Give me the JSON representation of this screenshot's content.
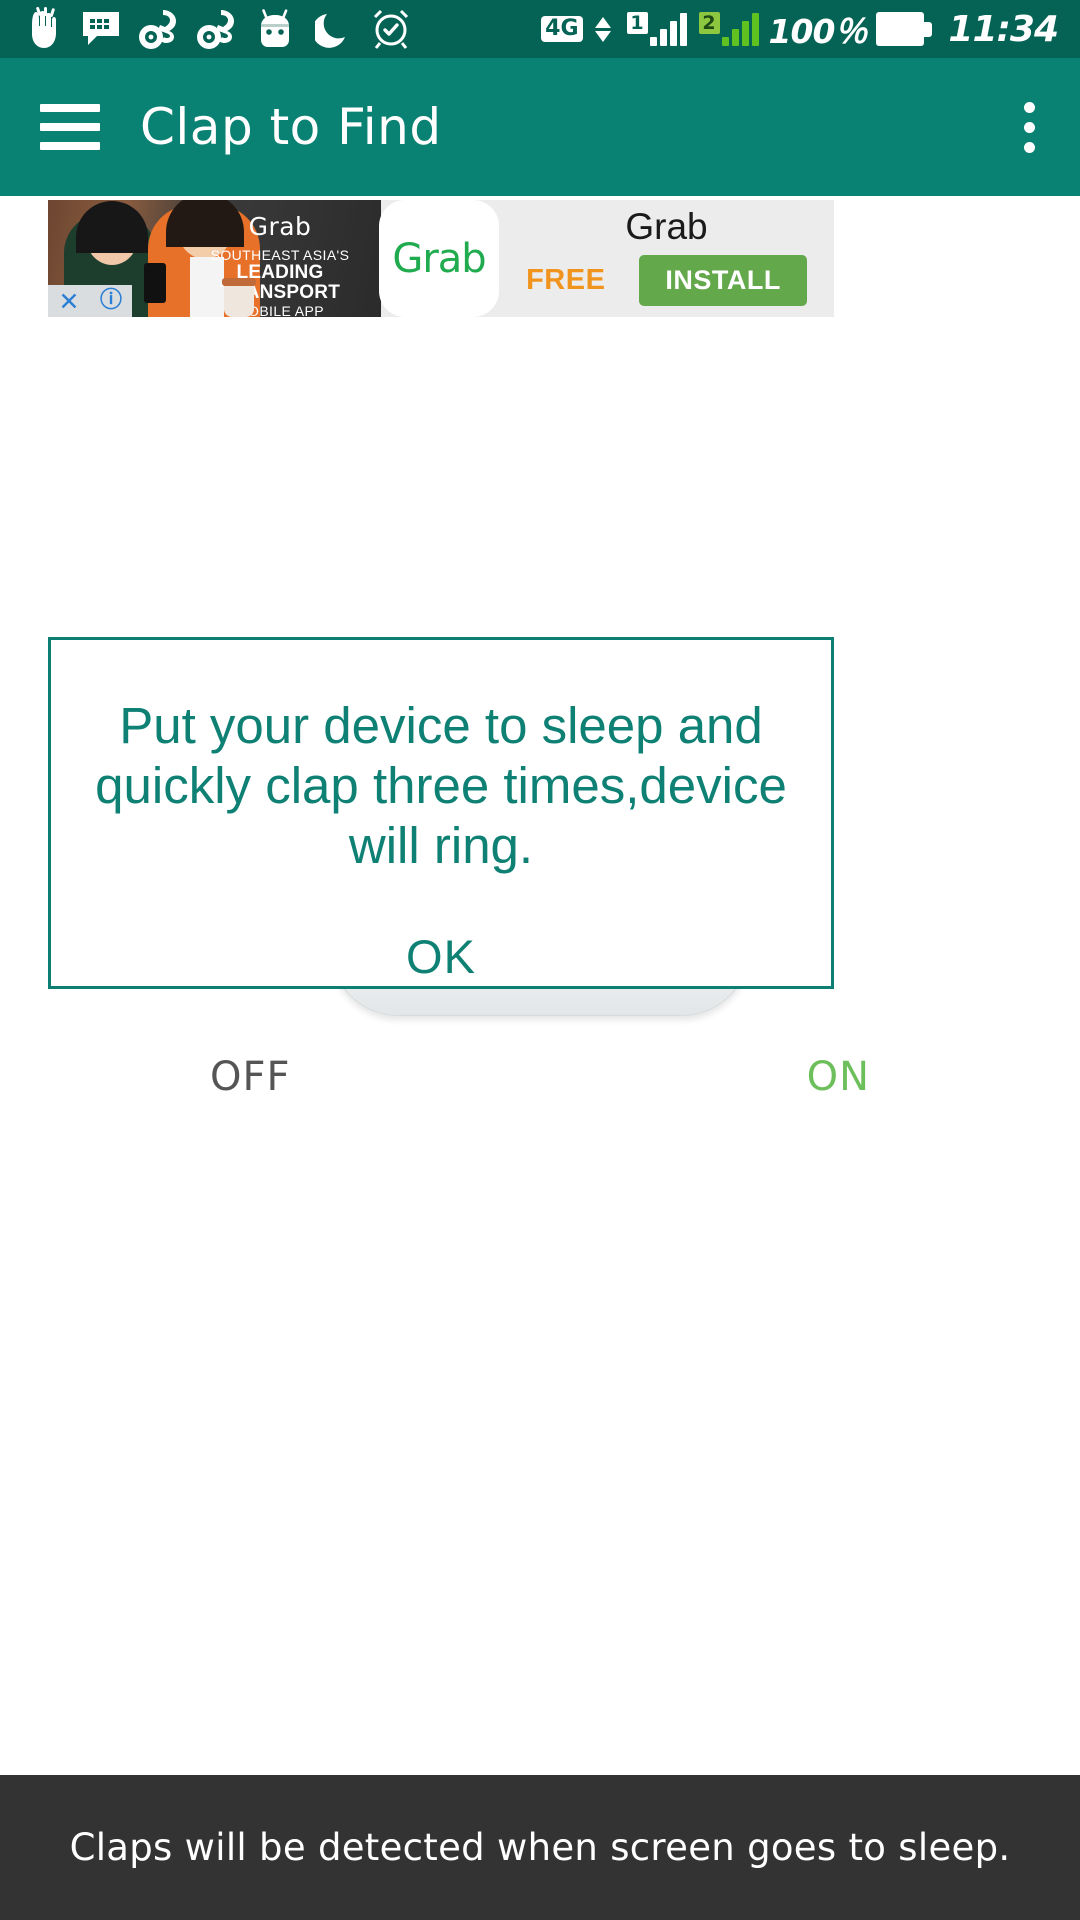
{
  "status_bar": {
    "background_color": "#056356",
    "icons": [
      {
        "name": "clap-hand-icon",
        "glyph": "✋"
      },
      {
        "name": "bbm-message-icon",
        "glyph": "⌨"
      },
      {
        "name": "uc-browser-icon-1",
        "glyph": "◔"
      },
      {
        "name": "uc-browser-icon-2",
        "glyph": "◔"
      },
      {
        "name": "android-mascot-icon",
        "glyph": "◕"
      },
      {
        "name": "do-not-disturb-moon-icon",
        "glyph": "☾"
      },
      {
        "name": "alarm-clock-icon",
        "glyph": "⏰"
      }
    ],
    "network_type": "4G",
    "sim1_label": "1",
    "sim2_label": "2",
    "battery_percent": "100％",
    "time": "11:34"
  },
  "app_bar": {
    "background_color": "#0a8273",
    "menu_icon": "hamburger-menu-icon",
    "title": "Clap to Find",
    "overflow_icon": "overflow-menu-icon"
  },
  "ad": {
    "creative_wordmark": "Grab",
    "creative_line1": "SOUTHEAST ASIA'S",
    "creative_line2": "LEADING TRANSPORT",
    "creative_line3": "MOBILE APP",
    "close_label": "✕",
    "info_label": "ⓘ",
    "logo_text": "Grab",
    "title": "Grab",
    "price_label": "FREE",
    "cta_label": "INSTALL",
    "cta_color": "#63a84b",
    "price_color": "#f0941e"
  },
  "dialog": {
    "message": "Put your device to sleep and quickly clap three times,device will ring.",
    "ok_label": "OK",
    "border_color": "#0d7f72",
    "text_color": "#0e8074"
  },
  "toggle": {
    "off_label": "OFF",
    "on_label": "ON",
    "off_color": "#555555",
    "on_color": "#6cbf5b",
    "state": "OFF"
  },
  "bottom_bar": {
    "text": "Claps will be detected when screen goes to sleep.",
    "background_color": "#333333",
    "text_color": "#ffffff"
  }
}
